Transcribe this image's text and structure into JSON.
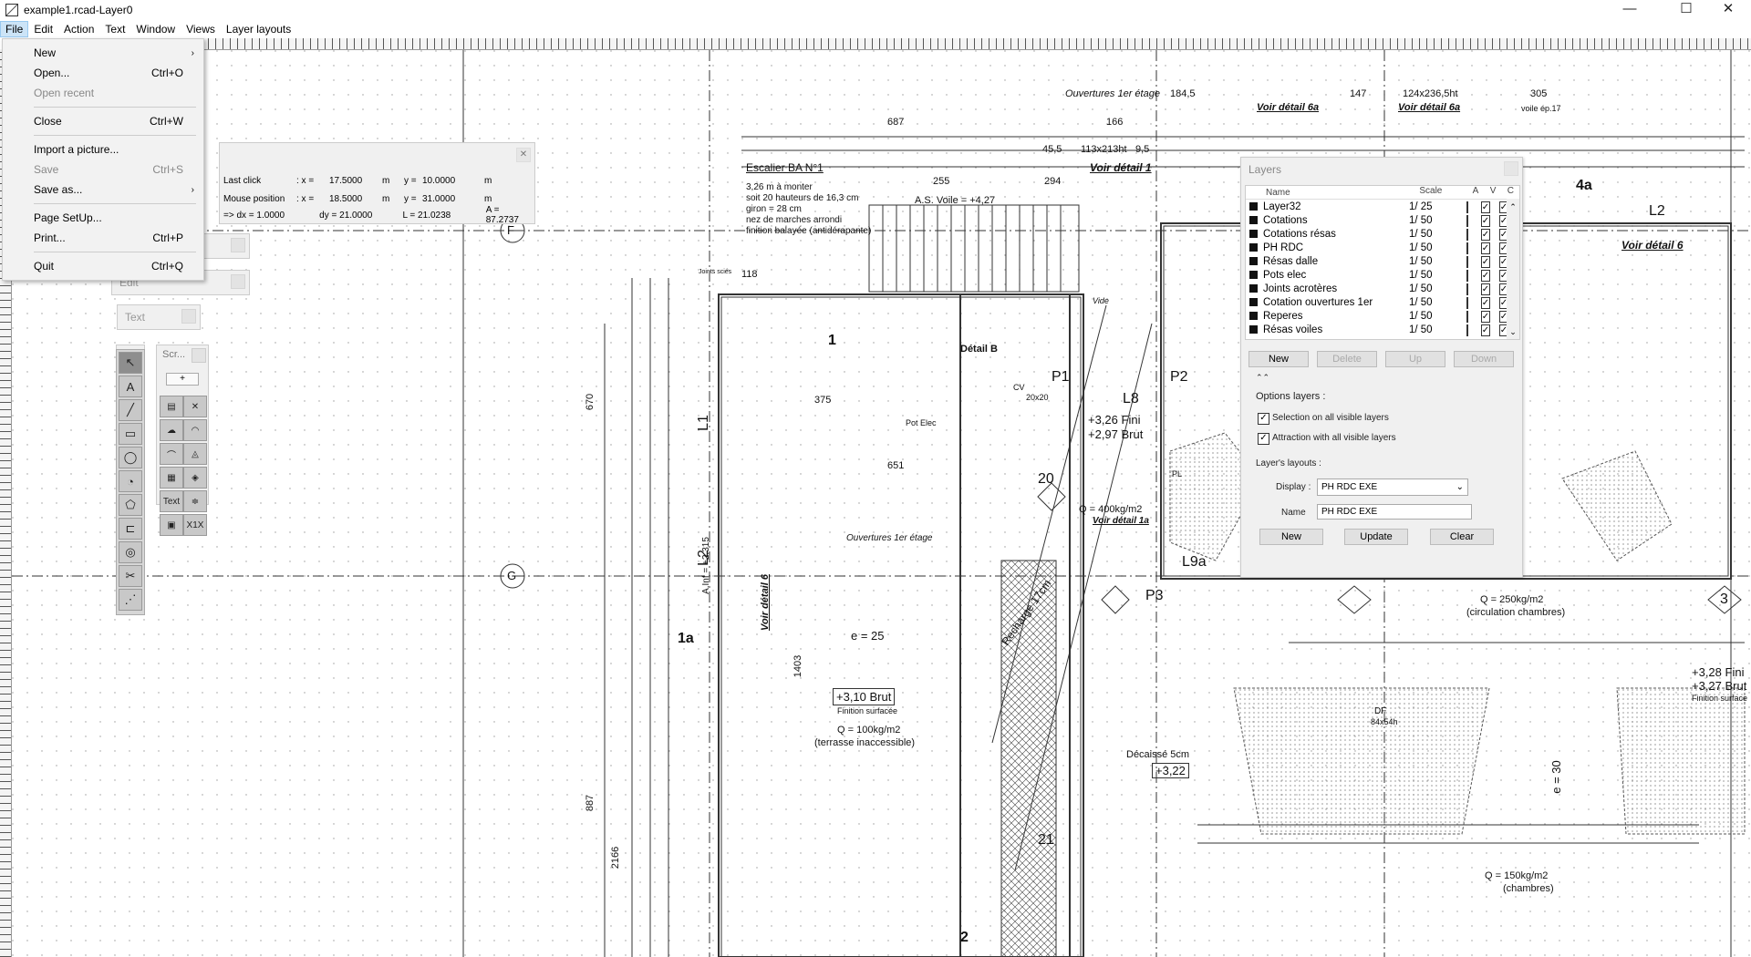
{
  "window": {
    "title": "example1.rcad-Layer0",
    "minimize": "—",
    "maximize": "☐",
    "close": "✕"
  },
  "menubar": [
    "File",
    "Edit",
    "Action",
    "Text",
    "Window",
    "Views",
    "Layer layouts"
  ],
  "file_menu": [
    {
      "label": "New",
      "shortcut": "",
      "arrow": true,
      "disabled": false
    },
    {
      "label": "Open...",
      "shortcut": "Ctrl+O",
      "arrow": false,
      "disabled": false
    },
    {
      "label": "Open recent",
      "shortcut": "",
      "arrow": false,
      "disabled": true
    },
    {
      "label": "Close",
      "shortcut": "Ctrl+W",
      "arrow": false,
      "disabled": false
    },
    {
      "label": "Import a picture...",
      "shortcut": "",
      "arrow": false,
      "disabled": false
    },
    {
      "label": "Save",
      "shortcut": "Ctrl+S",
      "arrow": false,
      "disabled": true
    },
    {
      "label": "Save as...",
      "shortcut": "",
      "arrow": true,
      "disabled": false
    },
    {
      "label": "Page SetUp...",
      "shortcut": "",
      "arrow": false,
      "disabled": false
    },
    {
      "label": "Print...",
      "shortcut": "Ctrl+P",
      "arrow": false,
      "disabled": false
    },
    {
      "label": "Quit",
      "shortcut": "Ctrl+Q",
      "arrow": false,
      "disabled": false
    }
  ],
  "coord_panel": {
    "last_click": {
      "label": "Last click",
      "x_label": ": x =",
      "x": "17.5000",
      "unit1": "m",
      "y_label": "y =",
      "y": "10.0000",
      "unit2": "m"
    },
    "mouse_position": {
      "label": "Mouse position",
      "x_label": ": x =",
      "x": "18.5000",
      "unit1": "m",
      "y_label": "y =",
      "y": "31.0000",
      "unit2": "m"
    },
    "delta": {
      "dx": "=> dx = 1.0000",
      "dy": "dy = 21.0000",
      "L": "L = 21.0238",
      "A": "A = 87.2737"
    }
  },
  "mini_panels": {
    "edit": "Edit",
    "text": "Text",
    "scr": "Scr...",
    "plus": "+"
  },
  "tools": [
    "↖",
    "A",
    "╱",
    "▭",
    "◯",
    "◔",
    "⬠",
    "⊏",
    "◎",
    "✂",
    "⋰"
  ],
  "scr_tools": [
    "▤",
    "✕",
    "☁",
    "◠",
    "⌒",
    "◬",
    "▦",
    "◈",
    "Text",
    "≑",
    "▣",
    "X1X"
  ],
  "layers_panel": {
    "title": "Layers",
    "headers": {
      "name": "Name",
      "scale": "Scale",
      "a": "A",
      "v": "V",
      "c": "C"
    },
    "rows": [
      {
        "name": "Layer32",
        "scale": "1/  25",
        "a": false,
        "v": true,
        "c": true
      },
      {
        "name": "Cotations",
        "scale": "1/  50",
        "a": false,
        "v": true,
        "c": true
      },
      {
        "name": "Cotations résas",
        "scale": "1/  50",
        "a": false,
        "v": true,
        "c": true
      },
      {
        "name": "PH RDC",
        "scale": "1/  50",
        "a": false,
        "v": true,
        "c": true
      },
      {
        "name": "Résas dalle",
        "scale": "1/  50",
        "a": false,
        "v": true,
        "c": true
      },
      {
        "name": "Pots elec",
        "scale": "1/  50",
        "a": false,
        "v": true,
        "c": true
      },
      {
        "name": "Joints acrotères",
        "scale": "1/  50",
        "a": false,
        "v": true,
        "c": true
      },
      {
        "name": "Cotation ouvertures 1er",
        "scale": "1/  50",
        "a": false,
        "v": true,
        "c": true
      },
      {
        "name": "Reperes",
        "scale": "1/  50",
        "a": false,
        "v": true,
        "c": true
      },
      {
        "name": "Résas voiles",
        "scale": "1/  50",
        "a": false,
        "v": true,
        "c": true
      }
    ],
    "buttons": {
      "new": "New",
      "delete": "Delete",
      "up": "Up",
      "down": "Down"
    },
    "options_label": "Options layers :",
    "opt_selection": "Selection on all visible layers",
    "opt_attraction": "Attraction with all visible layers",
    "layouts_label": "Layer's layouts :",
    "display_label": "Display :",
    "display_value": "PH RDC EXE",
    "name_label": "Name",
    "name_value": "PH RDC EXE",
    "layout_new": "New",
    "layout_update": "Update",
    "layout_clear": "Clear",
    "collapse": "⌃⌃"
  },
  "drawing": {
    "labels": [
      "Ouvertures 1er étage",
      "184,5",
      "Voir détail 6a",
      "147",
      "124x236,5ht",
      "Voir détail 6a",
      "305",
      "voile ép.17",
      "687",
      "166",
      "45,5",
      "113x213ht",
      "9,5",
      "Voir détail 1",
      "Escalier BA N°1",
      "3,26 m à monter",
      "soit 20 hauteurs de 16,3 cm",
      "giron = 28 cm",
      "nez de marches arrondi",
      "finition balayée (antidérapante)",
      "A.S. Voile = +4,27",
      "255",
      "294",
      "F",
      "G",
      "L1",
      "L2",
      "L8",
      "P1",
      "P2",
      "P3",
      "L9a",
      "20",
      "1",
      "1a",
      "e = 25",
      "+3,10 Brut",
      "Finition surfacée",
      "Q = 100kg/m2",
      "(terrasse inaccessible)",
      "+3,26 Fini",
      "+2,97 Brut",
      "Q = 400kg/m2",
      "Voir détail 1a",
      "Q = 250kg/m2",
      "(circulation chambres)",
      "Décaissé 5cm",
      "+3,22",
      "Q = 150kg/m2",
      "(chambres)",
      "Voir détail 6",
      "Détail B",
      "Ouvertures 1er étage",
      "375",
      "651",
      "1403",
      "670",
      "887",
      "2166",
      "4a",
      "L2",
      "Voir détail 6",
      "A.Inf = +2,315",
      "e = 30",
      "21",
      "2",
      "3",
      "+3,28 Fini",
      "+3,27 Brut",
      "Finition surface",
      "Recharge 17cm",
      "DF",
      "84x54h",
      "CV",
      "PL",
      "20x20",
      "Pot Elec",
      "Vide",
      "118",
      "Joints sciés"
    ]
  }
}
